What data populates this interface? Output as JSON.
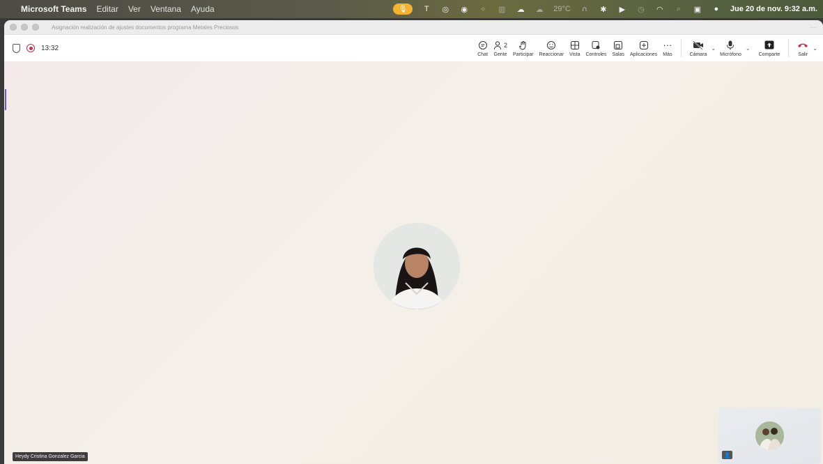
{
  "menubar": {
    "apple_icon": "apple-icon",
    "app_name": "Microsoft Teams",
    "menus": [
      "Editar",
      "Ver",
      "Ventana",
      "Ayuda"
    ],
    "weather": "29°C",
    "datetime": "Jue 20 de nov.  9:32 a.m."
  },
  "window": {
    "title": "Asignación realización de ajustes documentos programa Metales Preciosos",
    "more": "···"
  },
  "meeting": {
    "timer": "13:32",
    "people_count": "2",
    "toolbar": {
      "chat": "Chat",
      "people": "Gente",
      "raise": "Participar",
      "react": "Reaccionar",
      "view": "Vista",
      "controls": "Controles",
      "rooms": "Salas",
      "apps": "Aplicaciones",
      "more": "Más",
      "camera": "Cámara",
      "mic": "Micrófono",
      "share": "Comparte",
      "leave": "Salir"
    }
  },
  "stage": {
    "participant_name": "Heydy Cristina Gonzalez Garcia"
  },
  "colors": {
    "accent": "#5b5fc7",
    "leave": "#c4314b",
    "mic_pill": "#f2b232"
  }
}
